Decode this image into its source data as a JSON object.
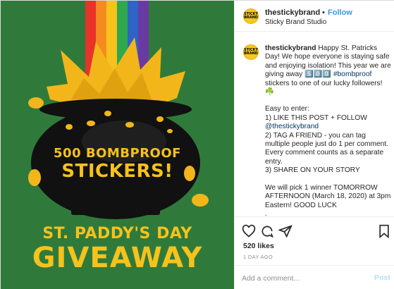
{
  "post": {
    "image": {
      "line1": "500 BOMBPROOF",
      "line2": "STICKERS!",
      "footer1": "ST. PADDY'S DAY",
      "footer2": "GIVEAWAY",
      "colors": {
        "background": "#2f7a3b",
        "text": "#f6c21c",
        "pot": "#111111",
        "coins": "#f2b61b",
        "rainbow": [
          "#e8332a",
          "#f58a1f",
          "#f6c21c",
          "#2fa84f",
          "#2f63c6",
          "#6a3aa3"
        ]
      }
    }
  },
  "header": {
    "avatar_text": "STICKY BRAND",
    "username": "thestickybrand",
    "dot": "•",
    "follow_label": "Follow",
    "location": "Sticky Brand Studio"
  },
  "caption": {
    "username": "thestickybrand",
    "intro": "Happy St. Patricks Day! We hope everyone is staying safe and enjoying isolation! This year we are giving away 5️⃣0️⃣0️⃣",
    "hashtag": "#bombproof",
    "intro_end": "stickers to one of our lucky followers! ☘️",
    "easy": "Easy to enter:",
    "step1_pre": "1) LIKE THIS POST + FOLLOW",
    "step1_handle": "@thestickybrand",
    "step2": "2) TAG A FRIEND - you can tag multiple people just do 1 per comment. Every comment counts as a separate entry.",
    "step3": "3) SHARE ON YOUR STORY",
    "winner": "We will pick 1 winner TOMORROW AFTERNOON (March 18, 2020) at 3pm Eastern! GOOD LUCK",
    "dot1": ".",
    "dot2": "."
  },
  "actions": {
    "icons": [
      "heart-icon",
      "comment-icon",
      "share-icon",
      "bookmark-icon"
    ],
    "likes": "520 likes",
    "timestamp": "1 DAY AGO"
  },
  "comment": {
    "placeholder": "Add a comment...",
    "post_label": "Post"
  }
}
